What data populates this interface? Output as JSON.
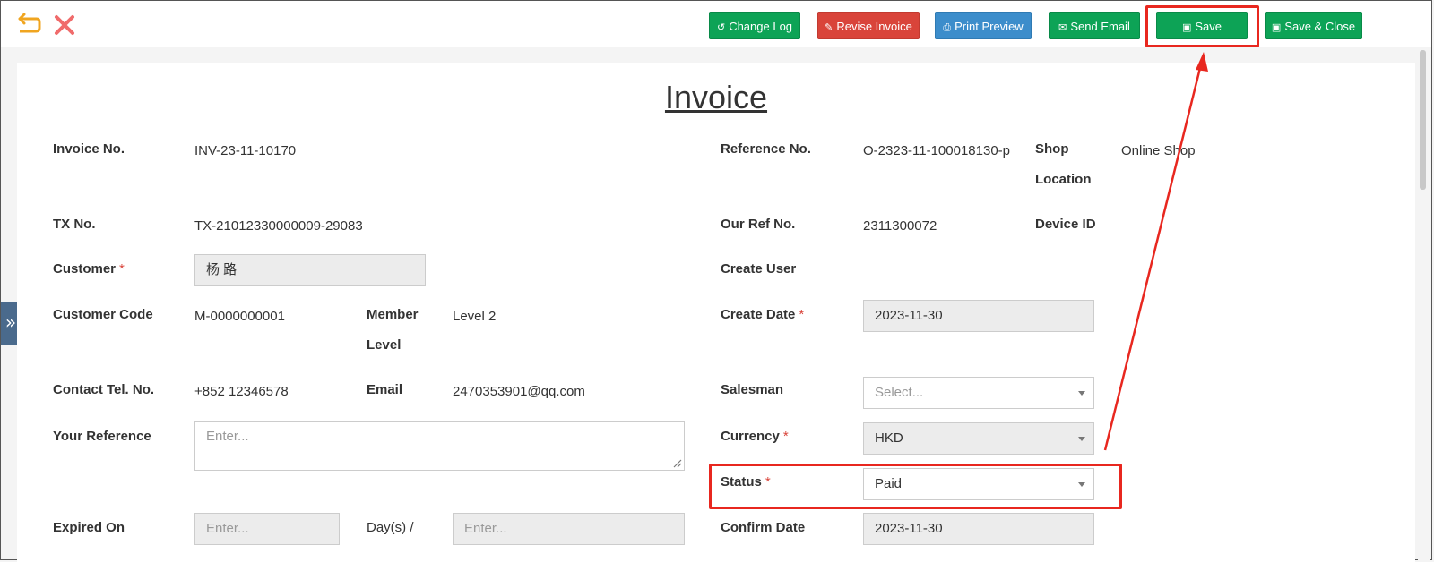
{
  "toolbar": {
    "back_icon": "back-arrow-icon",
    "close_icon": "close-icon",
    "change_log": "Change Log",
    "revise_invoice": "Revise Invoice",
    "print_preview": "Print Preview",
    "send_email": "Send Email",
    "save": "Save",
    "save_close": "Save & Close"
  },
  "page_title": "Invoice",
  "form": {
    "invoice_no": {
      "label": "Invoice No.",
      "value": "INV-23-11-10170"
    },
    "reference_no": {
      "label": "Reference No.",
      "value": "O-2323-11-100018130-p"
    },
    "shop_location": {
      "label_line1": "Shop",
      "label_line2": "Location",
      "value": "Online Shop"
    },
    "tx_no": {
      "label": "TX No.",
      "value": "TX-21012330000009-29083"
    },
    "our_ref_no": {
      "label": "Our Ref No.",
      "value": "2311300072"
    },
    "device_id": {
      "label": "Device ID"
    },
    "customer": {
      "label": "Customer",
      "value": "杨 路"
    },
    "create_user": {
      "label": "Create User"
    },
    "customer_code": {
      "label": "Customer Code",
      "value": "M-0000000001"
    },
    "member_level": {
      "label_line1": "Member",
      "label_line2": "Level",
      "value": "Level 2"
    },
    "create_date": {
      "label": "Create Date",
      "value": "2023-11-30"
    },
    "contact_tel": {
      "label": "Contact Tel. No.",
      "value": "+852 12346578"
    },
    "email": {
      "label": "Email",
      "value": "2470353901@qq.com"
    },
    "salesman": {
      "label": "Salesman",
      "placeholder": "Select..."
    },
    "your_reference": {
      "label": "Your Reference",
      "placeholder": "Enter..."
    },
    "currency": {
      "label": "Currency",
      "value": "HKD"
    },
    "status": {
      "label": "Status",
      "value": "Paid"
    },
    "expired_on": {
      "label": "Expired On",
      "placeholder": "Enter...",
      "days_label": "Day(s) /",
      "days_placeholder": "Enter..."
    },
    "confirm_date": {
      "label": "Confirm Date",
      "value": "2023-11-30"
    },
    "required_mark": "*"
  },
  "sidebar_toggle_icon": "double-chevron-right-icon",
  "colors": {
    "green": "#0da356",
    "red": "#d9443a",
    "blue": "#3c8dcb",
    "annotation": "#e8271f"
  }
}
